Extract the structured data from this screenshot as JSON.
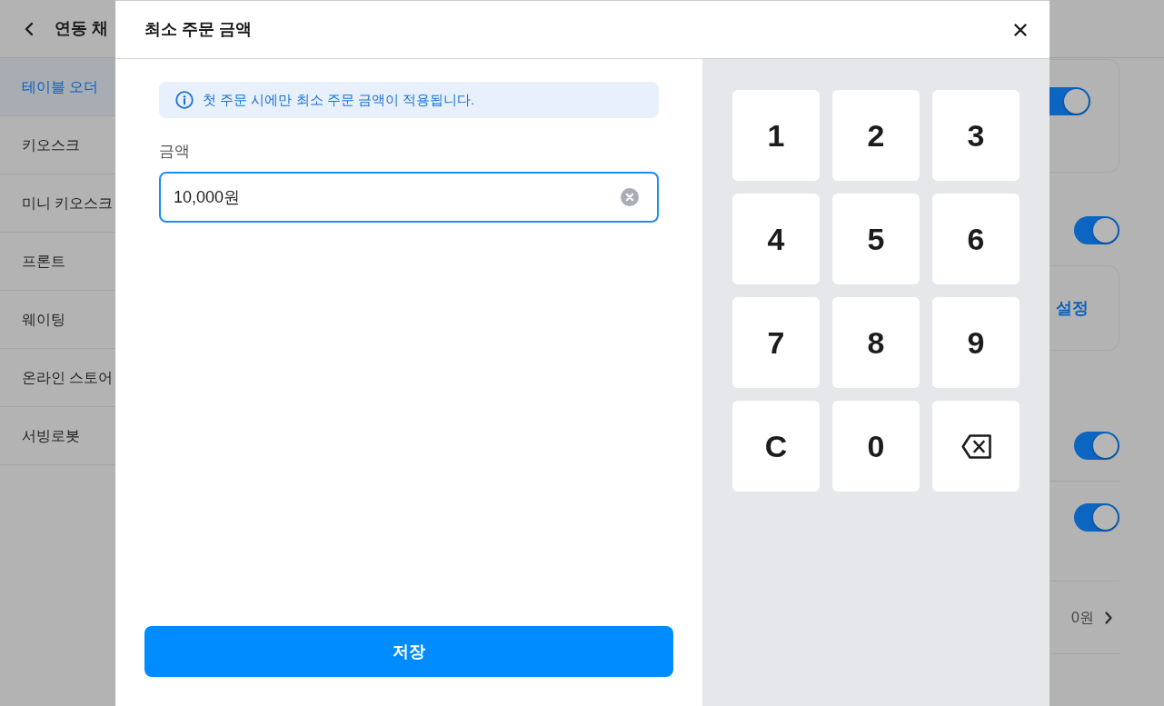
{
  "header": {
    "title": "연동 채"
  },
  "sidebar": {
    "items": [
      {
        "label": "테이블 오더",
        "selected": true
      },
      {
        "label": "키오스크",
        "selected": false
      },
      {
        "label": "미니 키오스크",
        "selected": false
      },
      {
        "label": "프론트",
        "selected": false
      },
      {
        "label": "웨이팅",
        "selected": false
      },
      {
        "label": "온라인 스토어",
        "selected": false
      },
      {
        "label": "서빙로봇",
        "selected": false
      }
    ]
  },
  "content": {
    "rows": [
      {
        "kind": "toggle_card",
        "on": true
      },
      {
        "kind": "toggle",
        "on": true
      },
      {
        "kind": "button_card",
        "label": "설정"
      },
      {
        "kind": "toggle",
        "on": true
      },
      {
        "kind": "toggle",
        "on": true
      },
      {
        "kind": "value",
        "value": "0원"
      }
    ]
  },
  "dialog": {
    "title": "최소 주문 금액",
    "notice": "첫 주문 시에만 최소 주문 금액이 적용됩니다.",
    "amount_field": {
      "label": "금액",
      "value": "10,000원"
    },
    "save_button": "저장",
    "keypad": [
      {
        "kind": "digit",
        "label": "1"
      },
      {
        "kind": "digit",
        "label": "2"
      },
      {
        "kind": "digit",
        "label": "3"
      },
      {
        "kind": "digit",
        "label": "4"
      },
      {
        "kind": "digit",
        "label": "5"
      },
      {
        "kind": "digit",
        "label": "6"
      },
      {
        "kind": "digit",
        "label": "7"
      },
      {
        "kind": "digit",
        "label": "8"
      },
      {
        "kind": "digit",
        "label": "9"
      },
      {
        "kind": "clear",
        "label": "C"
      },
      {
        "kind": "digit",
        "label": "0"
      },
      {
        "kind": "backspace"
      }
    ]
  }
}
